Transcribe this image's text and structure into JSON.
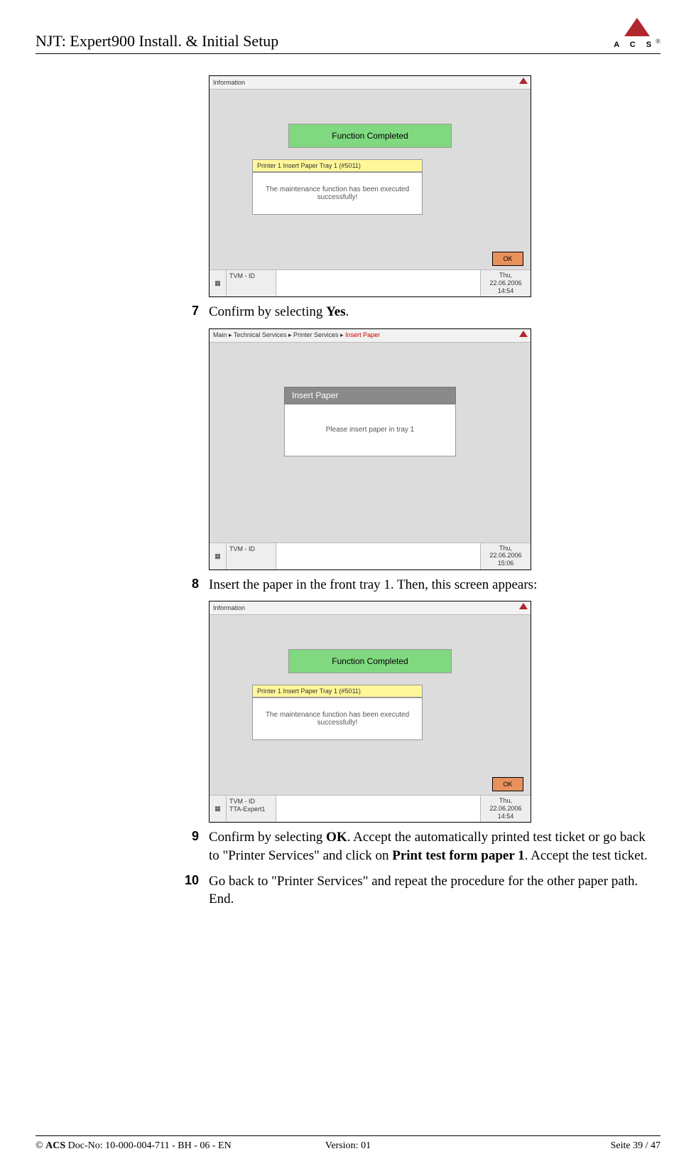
{
  "header": {
    "title": "NJT: Expert900 Install. & Initial Setup",
    "logo_letters": "A C S",
    "logo_r": "®"
  },
  "screenshot1": {
    "topbar": "Information",
    "banner": "Function Completed",
    "yellow": "Printer 1 Insert Paper Tray 1 (#5011)",
    "panel": "The maintenance function has been executed successfully!",
    "ok": "OK",
    "tvm": "TVM - ID",
    "ts_day": "Thu,",
    "ts_date": "22.06.2006",
    "ts_time": "14:54"
  },
  "step7": {
    "num": "7",
    "text_pre": "Confirm by selecting ",
    "text_bold": "Yes",
    "text_post": "."
  },
  "screenshot2": {
    "bc1": "Main",
    "bc2": "Technical Services",
    "bc3": "Printer Services",
    "bc4": "Insert Paper",
    "title": "Insert Paper",
    "panel": "Please insert paper in tray 1",
    "tvm": "TVM - ID",
    "ts_day": "Thu,",
    "ts_date": "22.06.2006",
    "ts_time": "15:06"
  },
  "step8": {
    "num": "8",
    "text": "Insert the paper in the front tray 1. Then, this screen appears:"
  },
  "screenshot3": {
    "topbar": "Information",
    "banner": "Function Completed",
    "yellow": "Printer 1 Insert Paper Tray 1 (#5011)",
    "panel": "The maintenance function has been executed successfully!",
    "ok": "OK",
    "tvm1": "TVM - ID",
    "tvm2": "TTA-Expert1",
    "ts_day": "Thu,",
    "ts_date": "22.06.2006",
    "ts_time": "14:54"
  },
  "step9": {
    "num": "9",
    "p1": "Confirm by selecting ",
    "b1": "OK",
    "p2": ". Accept the automatically printed test ticket or go back to \"Printer Services\" and click on ",
    "b2": "Print test form paper 1",
    "p3": ". Accept the test ticket."
  },
  "step10": {
    "num": "10",
    "text": "Go back to \"Printer Services\" and repeat the procedure for the other paper path. End."
  },
  "footer": {
    "left_copy": "©",
    "left_acs": "ACS",
    "left_rest": "  Doc-No: 10-000-004-711 - BH - 06 - EN",
    "center": "Version: 01",
    "right": "Seite 39 / 47"
  }
}
